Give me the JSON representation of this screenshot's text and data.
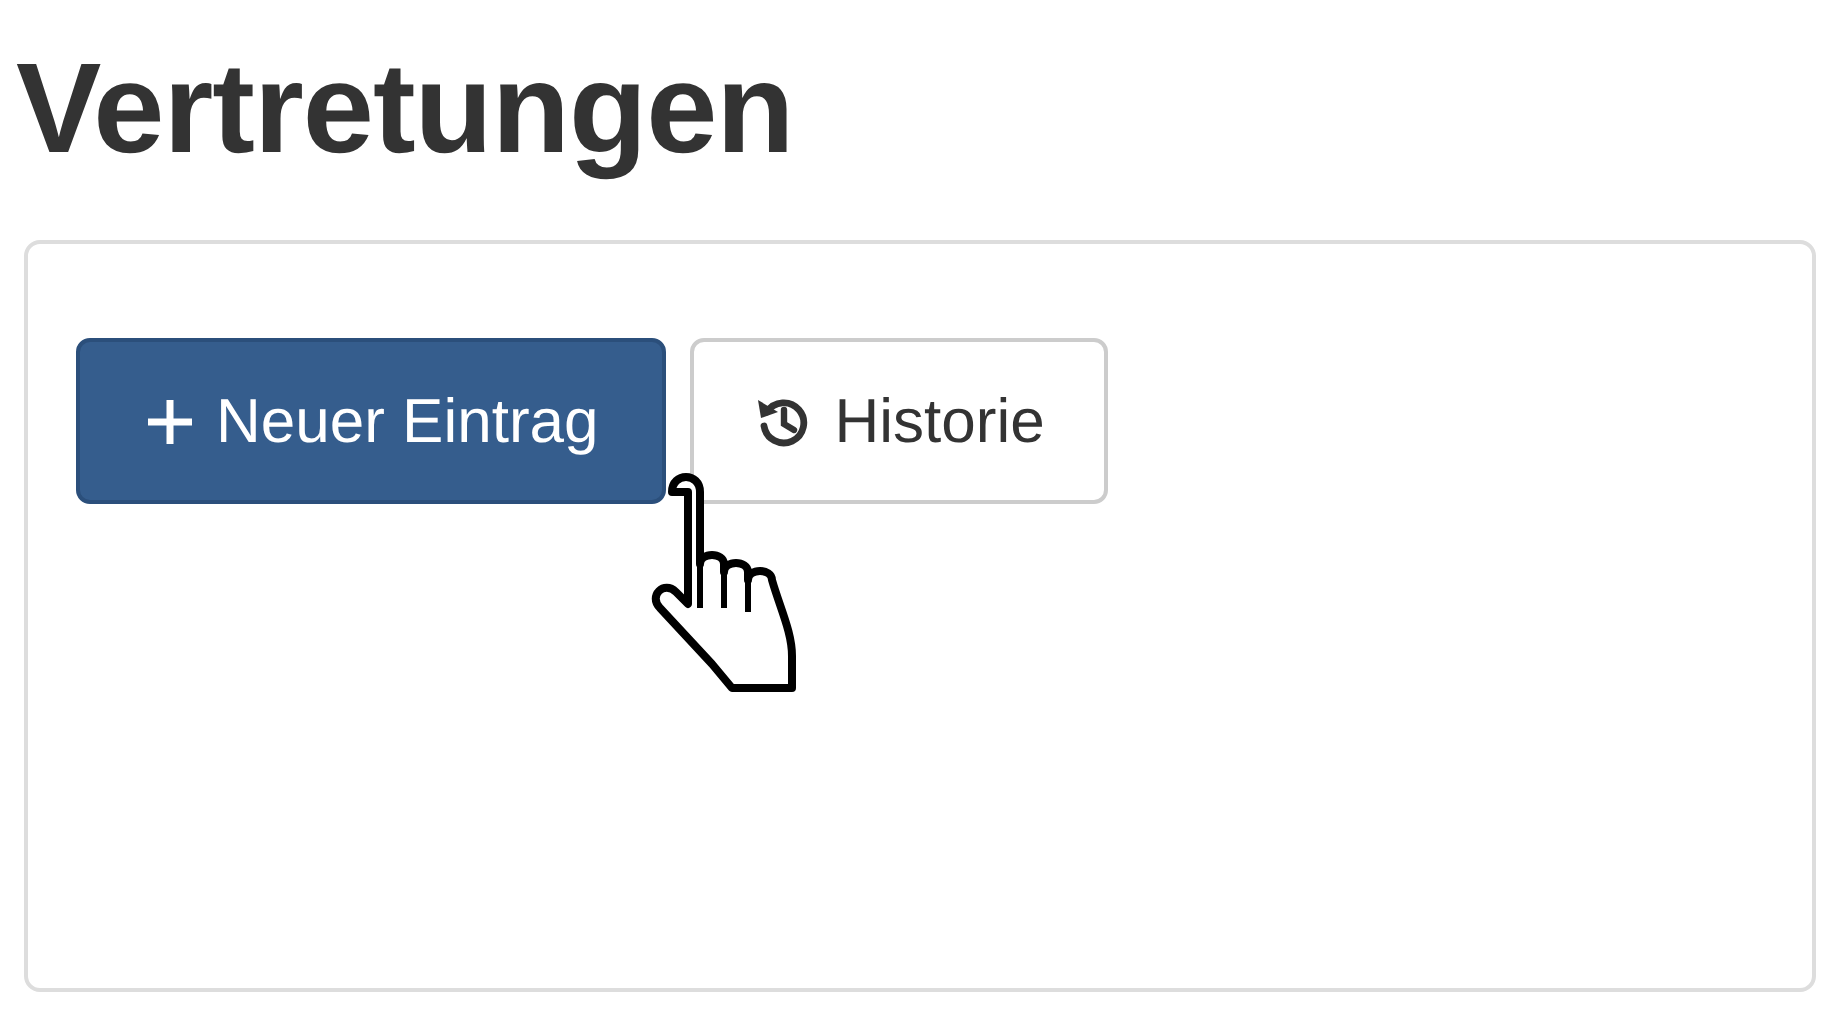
{
  "heading": "Vertretungen",
  "buttons": [
    {
      "kind": "primary",
      "label": "Neuer Eintrag"
    },
    {
      "kind": "secondary",
      "label": "Historie"
    }
  ]
}
